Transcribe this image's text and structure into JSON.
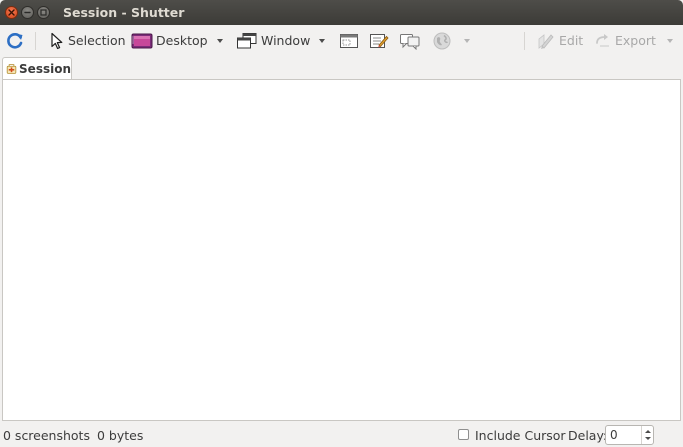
{
  "window": {
    "title": "Session - Shutter"
  },
  "toolbar": {
    "refresh_icon": "refresh-icon",
    "selection_label": "Selection",
    "desktop_label": "Desktop",
    "window_label": "Window",
    "edit_label": "Edit",
    "export_label": "Export"
  },
  "tabs": [
    {
      "label": "Session",
      "icon": "session-icon"
    }
  ],
  "status": {
    "screenshots": "0 screenshots",
    "size": "0 bytes",
    "include_cursor_label": "Include Cursor",
    "include_cursor_checked": false,
    "delay_label": "Delay:",
    "delay_value": "0"
  },
  "colors": {
    "titlebar": "#3c3b37",
    "close_button": "#df4a16",
    "window_bg": "#f2f1f0",
    "content_bg": "#ffffff",
    "disabled_text": "#a8a8a8"
  }
}
